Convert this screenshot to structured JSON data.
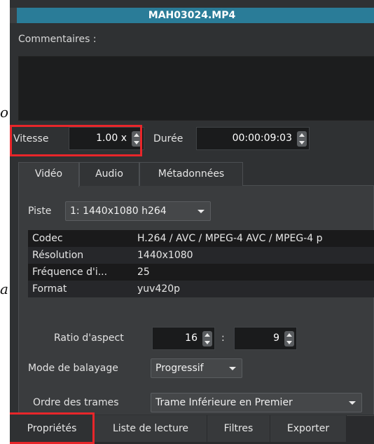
{
  "edge_glyphs": {
    "top": "o",
    "bottom": "a"
  },
  "file": {
    "title": "MAH03024.MP4"
  },
  "comments": {
    "label": "Commentaires :"
  },
  "speed": {
    "label": "Vitesse",
    "value": "1.00 x"
  },
  "duration": {
    "label": "Durée",
    "value": "00:00:09:03"
  },
  "tabs": [
    {
      "label": "Vidéo",
      "active": true
    },
    {
      "label": "Audio",
      "active": false
    },
    {
      "label": "Métadonnées",
      "active": false
    }
  ],
  "track": {
    "label": "Piste",
    "selected": "1: 1440x1080 h264"
  },
  "properties": [
    {
      "key": "Codec",
      "value": "H.264 / AVC / MPEG-4 AVC / MPEG-4 p"
    },
    {
      "key": "Résolution",
      "value": "1440x1080"
    },
    {
      "key": "Fréquence d'i...",
      "value": "25"
    },
    {
      "key": "Format",
      "value": "yuv420p"
    }
  ],
  "aspect": {
    "label": "Ratio d'aspect",
    "num": "16",
    "sep": ":",
    "den": "9"
  },
  "scan_mode": {
    "label": "Mode de balayage",
    "selected": "Progressif"
  },
  "field_order": {
    "label": "Ordre des trames",
    "selected": "Trame Inférieure en Premier"
  },
  "bottom_tabs": [
    {
      "label": "Propriétés",
      "active": true
    },
    {
      "label": "Liste de lecture",
      "active": false
    },
    {
      "label": "Filtres",
      "active": false
    },
    {
      "label": "Exporter",
      "active": false
    }
  ],
  "colors": {
    "title_bar": "#2a7c98",
    "highlight": "#e8262a",
    "panel_bg": "#2f3133"
  }
}
